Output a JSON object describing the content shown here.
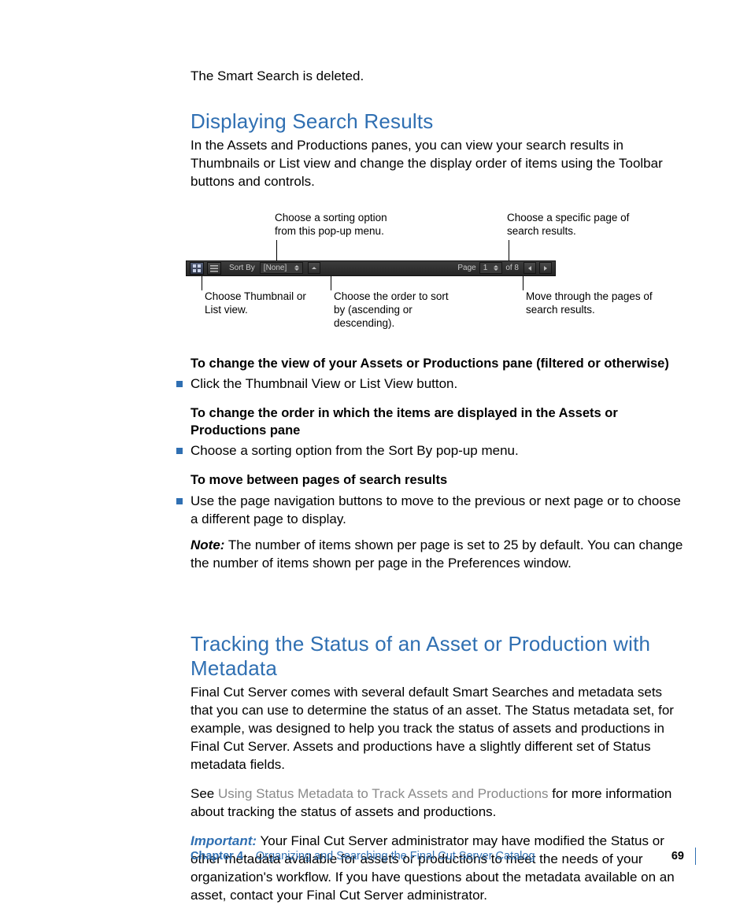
{
  "intro": "The Smart Search is deleted.",
  "section1": {
    "title": "Displaying Search Results",
    "para": "In the Assets and Productions panes, you can view your search results in Thumbnails or List view and change the display order of items using the Toolbar buttons and controls."
  },
  "diagram": {
    "callout_top_left": "Choose a sorting option from this pop-up menu.",
    "callout_top_right": "Choose a specific page of search results.",
    "callout_bottom_1": "Choose Thumbnail or List view.",
    "callout_bottom_2": "Choose the order to sort by (ascending or descending).",
    "callout_bottom_3": "Move through the pages of search results.",
    "toolbar": {
      "sort_by_label": "Sort By",
      "sort_by_value": "[None]",
      "page_label": "Page",
      "page_current": "1",
      "of_label": "of 8"
    }
  },
  "instr1": {
    "head": "To change the view of your Assets or Productions pane (filtered or otherwise)",
    "bullet": "Click the Thumbnail View or List View button."
  },
  "instr2": {
    "head": "To change the order in which the items are displayed in the Assets or Productions pane",
    "bullet": "Choose a sorting option from the Sort By pop-up menu."
  },
  "instr3": {
    "head": "To move between pages of search results",
    "bullet": "Use the page navigation buttons to move to the previous or next page or to choose a different page to display."
  },
  "note": {
    "label": "Note:",
    "text": "  The number of items shown per page is set to 25 by default. You can change the number of items shown per page in the Preferences window."
  },
  "section2": {
    "title": "Tracking the Status of an Asset or Production with Metadata",
    "para1": "Final Cut Server comes with several default Smart Searches and metadata sets that you can use to determine the status of an asset. The Status metadata set, for example, was designed to help you track the status of assets and productions in Final Cut Server. Assets and productions have a slightly different set of Status metadata fields.",
    "see_prefix": "See ",
    "see_link": "Using Status Metadata to Track Assets and Productions",
    "see_suffix": " for more information about tracking the status of assets and productions.",
    "important_label": "Important:",
    "important_text": "  Your Final Cut Server administrator may have modified the Status or other metadata available for assets or productions to meet the needs of your organization's workflow. If you have questions about the metadata available on an asset, contact your Final Cut Server administrator."
  },
  "footer": {
    "chapter": "Chapter 4",
    "title": "Organizing and Searching the Final Cut Server Catalog",
    "page": "69"
  }
}
